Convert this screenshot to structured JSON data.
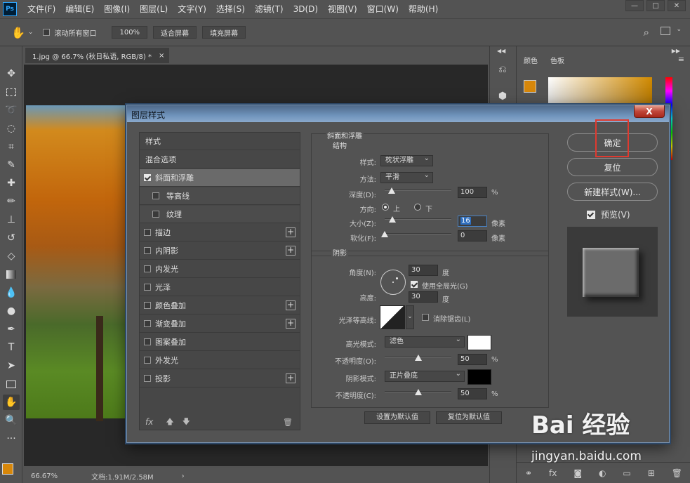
{
  "menubar": {
    "logo": "Ps",
    "items": [
      "文件(F)",
      "编辑(E)",
      "图像(I)",
      "图层(L)",
      "文字(Y)",
      "选择(S)",
      "滤镜(T)",
      "3D(D)",
      "视图(V)",
      "窗口(W)",
      "帮助(H)"
    ],
    "window_controls": [
      "—",
      "□",
      "✕"
    ]
  },
  "options_bar": {
    "scroll_all_label": "滚动所有窗口",
    "zoom_value": "100%",
    "fit_screen_label": "适合屏幕",
    "fill_screen_label": "填充屏幕"
  },
  "document": {
    "tab_title": "1.jpg @ 66.7% (秋日私语, RGB/8) *",
    "tab_close": "×",
    "zoom_status": "66.67%",
    "doc_info": "文档:1.91M/2.58M"
  },
  "right_panel": {
    "tab_color": "颜色",
    "tab_swatches": "色板"
  },
  "dialog": {
    "title": "图层样式",
    "close_label": "X",
    "styles_list": {
      "header": "样式",
      "blend_options": "混合选项",
      "items": [
        {
          "label": "斜面和浮雕",
          "checked": true,
          "sub": false,
          "plus": false,
          "selected": true
        },
        {
          "label": "等高线",
          "checked": false,
          "sub": true,
          "plus": false,
          "selected": false
        },
        {
          "label": "纹理",
          "checked": false,
          "sub": true,
          "plus": false,
          "selected": false
        },
        {
          "label": "描边",
          "checked": false,
          "sub": false,
          "plus": true,
          "selected": false
        },
        {
          "label": "内阴影",
          "checked": false,
          "sub": false,
          "plus": true,
          "selected": false
        },
        {
          "label": "内发光",
          "checked": false,
          "sub": false,
          "plus": false,
          "selected": false
        },
        {
          "label": "光泽",
          "checked": false,
          "sub": false,
          "plus": false,
          "selected": false
        },
        {
          "label": "颜色叠加",
          "checked": false,
          "sub": false,
          "plus": true,
          "selected": false
        },
        {
          "label": "渐变叠加",
          "checked": false,
          "sub": false,
          "plus": true,
          "selected": false
        },
        {
          "label": "图案叠加",
          "checked": false,
          "sub": false,
          "plus": false,
          "selected": false
        },
        {
          "label": "外发光",
          "checked": false,
          "sub": false,
          "plus": false,
          "selected": false
        },
        {
          "label": "投影",
          "checked": false,
          "sub": false,
          "plus": true,
          "selected": false
        }
      ],
      "fx_label": "fx"
    },
    "bevel": {
      "group_title": "斜面和浮雕",
      "structure_title": "结构",
      "style_label": "样式:",
      "style_value": "枕状浮雕",
      "technique_label": "方法:",
      "technique_value": "平滑",
      "depth_label": "深度(D):",
      "depth_value": "100",
      "depth_slider": 0.1,
      "direction_label": "方向:",
      "direction_up": "上",
      "direction_down": "下",
      "size_label": "大小(Z):",
      "size_value": "16",
      "size_slider": 0.12,
      "soften_label": "软化(F):",
      "soften_value": "0",
      "soften_slider": 0.0,
      "unit_percent": "%",
      "unit_pixel": "像素"
    },
    "shading": {
      "group_title": "阴影",
      "angle_label": "角度(N):",
      "angle_value": "30",
      "degree_unit": "度",
      "global_light_label": "使用全局光(G)",
      "altitude_label": "高度:",
      "altitude_value": "30",
      "gloss_label": "光泽等高线:",
      "anti_alias_label": "消除锯齿(L)",
      "highlight_mode_label": "高光模式:",
      "highlight_mode_value": "滤色",
      "highlight_color": "#ffffff",
      "highlight_opacity_label": "不透明度(O):",
      "highlight_opacity_value": "50",
      "highlight_opacity_slider": 0.5,
      "shadow_mode_label": "阴影模式:",
      "shadow_mode_value": "正片叠底",
      "shadow_color": "#000000",
      "shadow_opacity_label": "不透明度(C):",
      "shadow_opacity_value": "50",
      "shadow_opacity_slider": 0.5,
      "unit_percent": "%"
    },
    "make_default": "设置为默认值",
    "reset_default": "复位为默认值",
    "ok_label": "确定",
    "reset_label": "复位",
    "new_style_label": "新建样式(W)...",
    "preview_label": "预览(V)"
  },
  "watermark": {
    "logo": "Bai 经验",
    "sub": "jingyan.baidu.com"
  }
}
